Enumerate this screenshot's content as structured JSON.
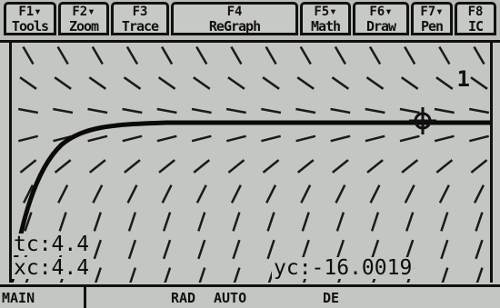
{
  "toolbar": {
    "keys": [
      {
        "key": "F1▾",
        "label": "Tools"
      },
      {
        "key": "F2▾",
        "label": "Zoom"
      },
      {
        "key": "F3",
        "label": "Trace"
      },
      {
        "key": "F4",
        "label": "ReGraph"
      },
      {
        "key": "F5▾",
        "label": "Math"
      },
      {
        "key": "F6▾",
        "label": "Draw"
      },
      {
        "key": "F7▾",
        "label": "Pen"
      },
      {
        "key": "F8",
        "label": "IC"
      }
    ]
  },
  "graph": {
    "graph_number": "1",
    "readouts": {
      "tc": "tc:4.4",
      "xc": "xc:4.4",
      "yc": "yc:-16.0019"
    },
    "cursor_icon": "crosshair-cursor-icon"
  },
  "status": {
    "folder": "MAIN",
    "angle_mode": "RAD",
    "exact_mode": "AUTO",
    "graph_mode": "DE"
  },
  "colors": {
    "screen": "#c3c6c1",
    "ink": "#111111"
  }
}
